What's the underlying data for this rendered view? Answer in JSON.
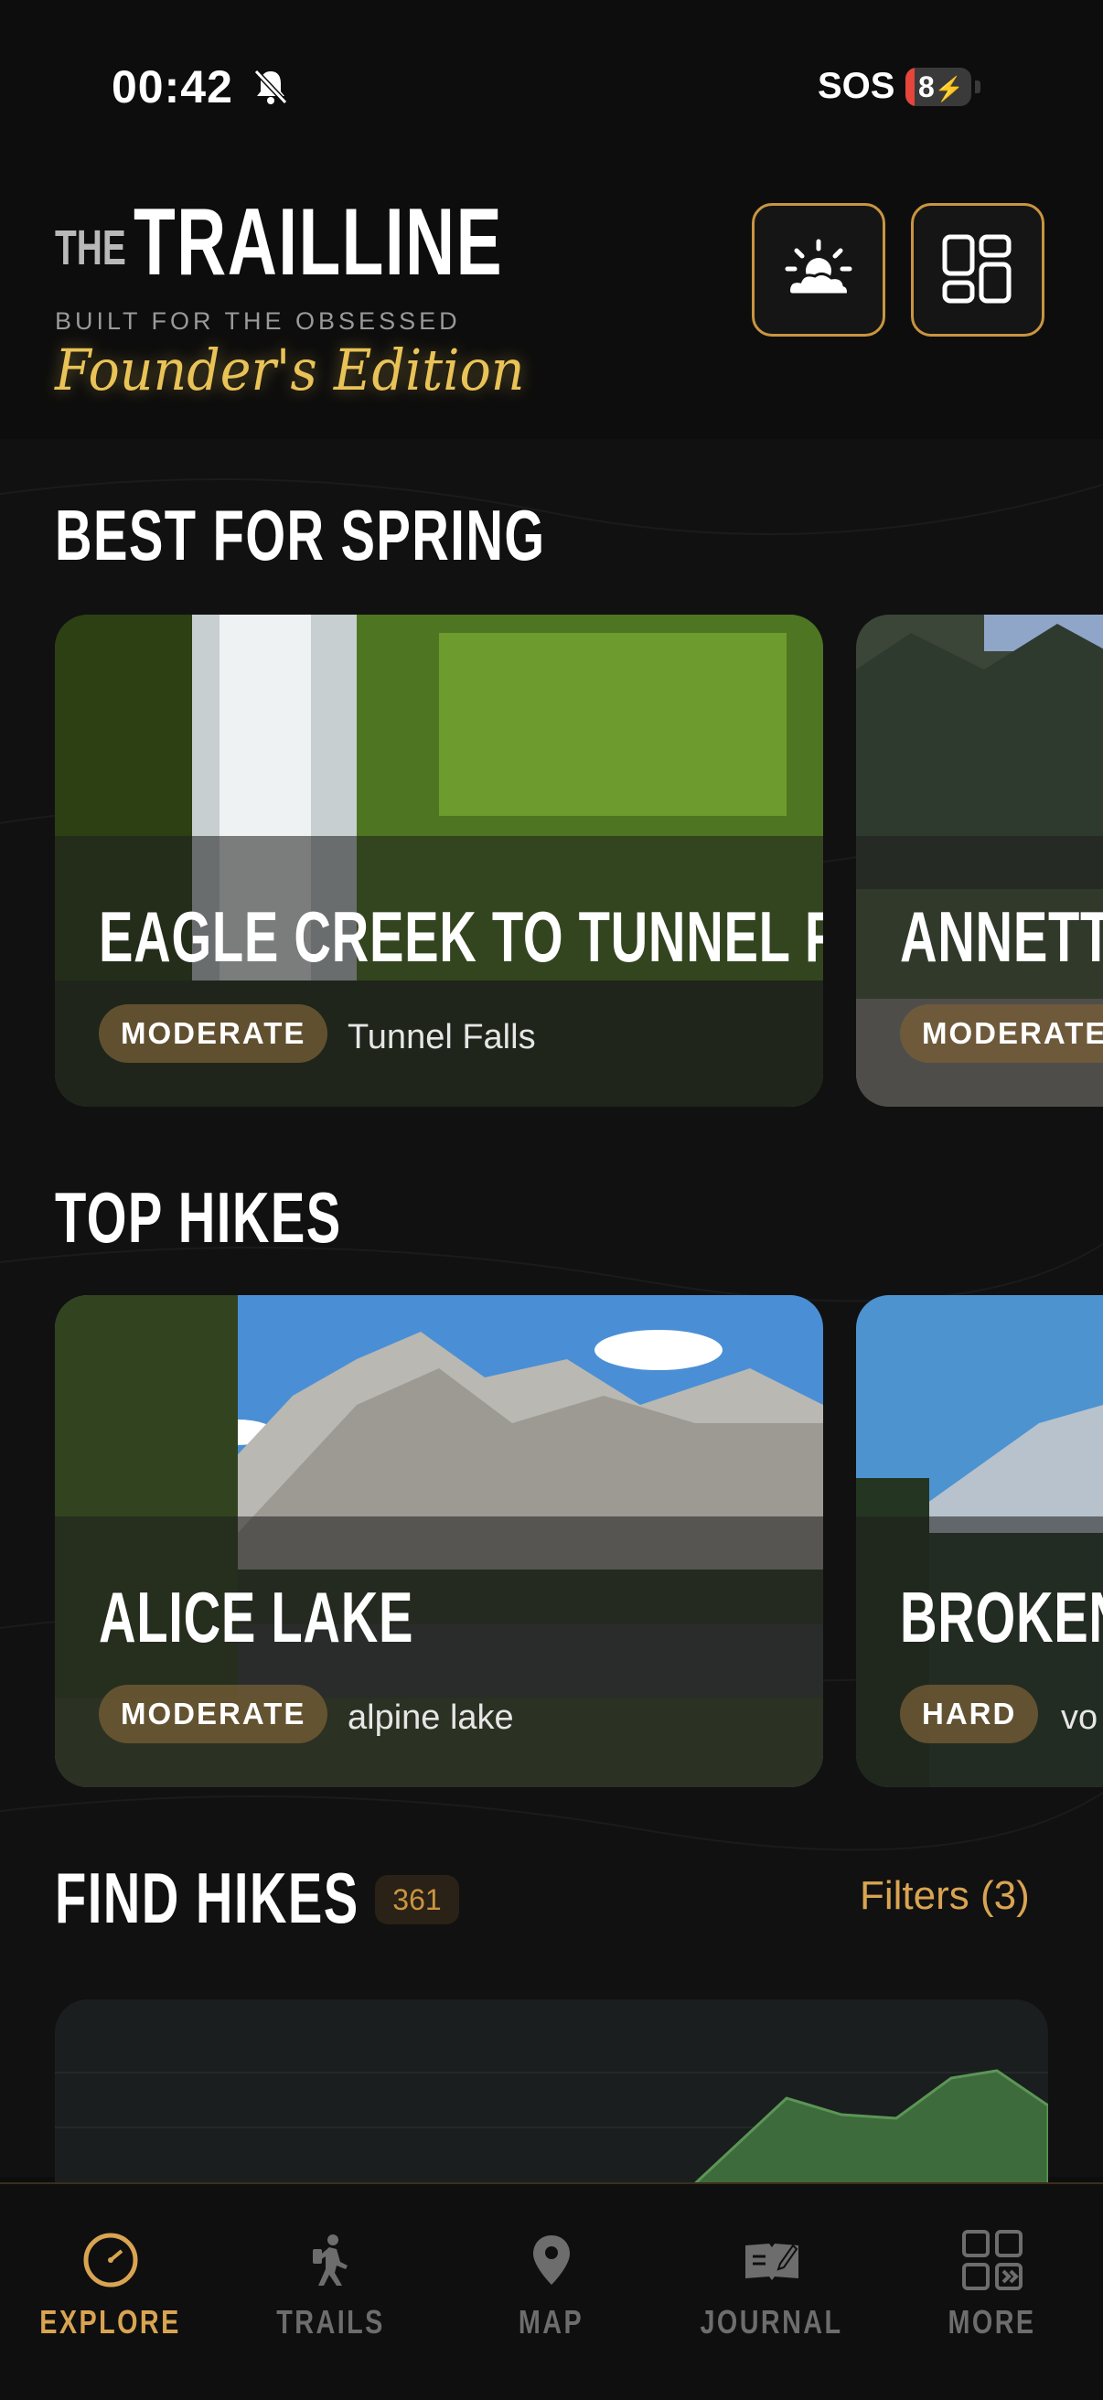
{
  "status_bar": {
    "time": "00:42",
    "carrier": "SOS",
    "battery": "8"
  },
  "brand": {
    "the": "THE",
    "name": "TRAILLINE",
    "tagline": "BUILT FOR THE OBSESSED",
    "edition": "Founder's Edition"
  },
  "header_buttons": {
    "weather_icon": "sun-cloud-icon",
    "layout_icon": "grid-layout-icon"
  },
  "sections": {
    "spring": {
      "title": "BEST FOR SPRING",
      "cards": [
        {
          "title": "EAGLE CREEK TO TUNNEL FALLS",
          "difficulty": "MODERATE",
          "tag": "Tunnel Falls"
        },
        {
          "title": "ANNETTE",
          "difficulty": "MODERATE",
          "tag": ""
        }
      ]
    },
    "top_hikes": {
      "title": "TOP HIKES",
      "cards": [
        {
          "title": "ALICE LAKE",
          "difficulty": "MODERATE",
          "tag": "alpine lake"
        },
        {
          "title": "BROKEN T",
          "difficulty": "HARD",
          "tag": "vo"
        }
      ]
    },
    "find_hikes": {
      "title": "FIND HIKES",
      "count": "361",
      "filters": "Filters (3)"
    }
  },
  "tabs": [
    {
      "label": "EXPLORE",
      "icon": "compass-icon",
      "active": true
    },
    {
      "label": "TRAILS",
      "icon": "hiker-icon",
      "active": false
    },
    {
      "label": "MAP",
      "icon": "map-pin-icon",
      "active": false
    },
    {
      "label": "JOURNAL",
      "icon": "journal-icon",
      "active": false
    },
    {
      "label": "MORE",
      "icon": "more-grid-icon",
      "active": false
    }
  ],
  "colors": {
    "accent": "#d9a452",
    "edition": "#e9c357",
    "background": "#0d0d0d"
  }
}
